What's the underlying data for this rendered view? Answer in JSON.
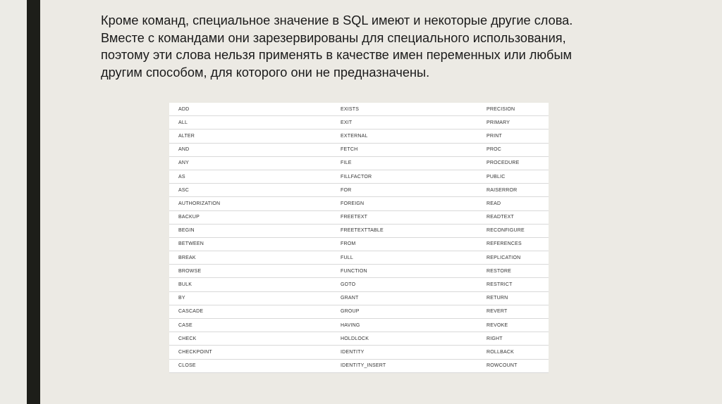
{
  "slide": {
    "paragraph_lines": [
      "Кроме команд, специальное значение в SQL имеют и некоторые другие слова.",
      "Вместе с командами они зарезервированы для специального использования,",
      "поэтому эти слова нельзя применять в качестве имен переменных или любым",
      "другим способом, для которого они не предназначены."
    ]
  },
  "reserved_words_table": {
    "rows": [
      [
        "ADD",
        "EXISTS",
        "PRECISION"
      ],
      [
        "ALL",
        "EXIT",
        "PRIMARY"
      ],
      [
        "ALTER",
        "EXTERNAL",
        "PRINT"
      ],
      [
        "AND",
        "FETCH",
        "PROC"
      ],
      [
        "ANY",
        "FILE",
        "PROCEDURE"
      ],
      [
        "AS",
        "FILLFACTOR",
        "PUBLIC"
      ],
      [
        "ASC",
        "FOR",
        "RAISERROR"
      ],
      [
        "AUTHORIZATION",
        "FOREIGN",
        "READ"
      ],
      [
        "BACKUP",
        "FREETEXT",
        "READTEXT"
      ],
      [
        "BEGIN",
        "FREETEXTTABLE",
        "RECONFIGURE"
      ],
      [
        "BETWEEN",
        "FROM",
        "REFERENCES"
      ],
      [
        "BREAK",
        "FULL",
        "REPLICATION"
      ],
      [
        "BROWSE",
        "FUNCTION",
        "RESTORE"
      ],
      [
        "BULK",
        "GOTO",
        "RESTRICT"
      ],
      [
        "BY",
        "GRANT",
        "RETURN"
      ],
      [
        "CASCADE",
        "GROUP",
        "REVERT"
      ],
      [
        "CASE",
        "HAVING",
        "REVOKE"
      ],
      [
        "CHECK",
        "HOLDLOCK",
        "RIGHT"
      ],
      [
        "CHECKPOINT",
        "IDENTITY",
        "ROLLBACK"
      ],
      [
        "CLOSE",
        "IDENTITY_INSERT",
        "ROWCOUNT"
      ]
    ]
  }
}
